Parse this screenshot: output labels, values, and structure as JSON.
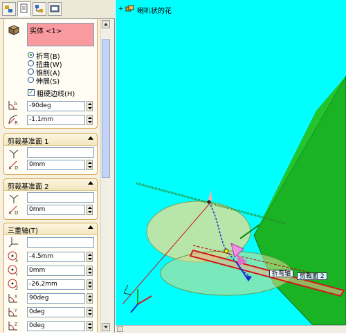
{
  "property_manager": {
    "bodies_list": {
      "items": [
        "实体 <1>"
      ]
    },
    "deform_options": [
      {
        "label": "折弯(B)",
        "selected": true
      },
      {
        "label": "扭曲(W)",
        "selected": false
      },
      {
        "label": "锥削(A)",
        "selected": false
      },
      {
        "label": "伸展(S)",
        "selected": false
      }
    ],
    "rough_edges": {
      "label": "粗硬边线(H)",
      "checked": true
    },
    "angle_value": "-90deg",
    "radius_value": "-1.1mm",
    "trim_plane_1": {
      "title": "剪裁基准面 1",
      "distance": "0mm"
    },
    "trim_plane_2": {
      "title": "剪裁基准面 2",
      "distance": "0mm"
    },
    "triad": {
      "title": "三重轴(T)",
      "x_rotation_origin": "-4.5mm",
      "y_rotation_origin": "0mm",
      "z_rotation_origin": "-26.2mm",
      "x_angle": "90deg",
      "y_angle": "0deg",
      "z_angle": "0deg"
    }
  },
  "viewport": {
    "feature_tree_root": "喇叭状的花",
    "callouts": [
      "折弯轴",
      "剪裁面 2"
    ],
    "background_color": "#00ffff"
  }
}
